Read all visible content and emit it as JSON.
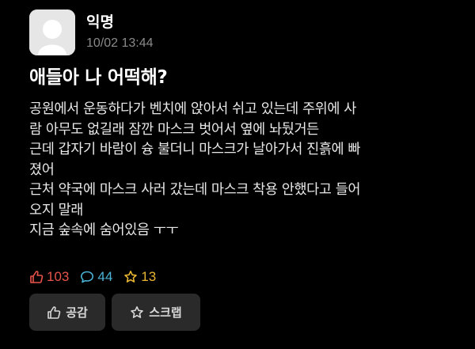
{
  "post": {
    "author": "익명",
    "date": "10/02 13:44",
    "title": "애들아 나 어떡해?",
    "content_lines": [
      "공원에서 운동하다가 벤치에 앉아서 쉬고 있는데 주위에 사",
      "람 아무도 없길래 잠깐 마스크 벗어서 옆에 놔뒀거든",
      "근데 갑자기 바람이 슝 불더니 마스크가 날아가서 진흙에 빠",
      "졌어",
      "근처 약국에 마스크 사러 갔는데 마스크 착용 안했다고 들어",
      "오지 말래",
      "지금 숲속에 숨어있음 ㅜㅜ"
    ]
  },
  "stats": {
    "likes": "103",
    "comments": "44",
    "scraps": "13"
  },
  "actions": {
    "like_label": "공감",
    "scrap_label": "스크랩"
  },
  "colors": {
    "background": "#000000",
    "like": "#e8534a",
    "comment": "#4ab3d6",
    "scrap": "#e9b631",
    "button_bg": "#2a2a2a"
  },
  "icons": {
    "like": "thumbs-up-icon",
    "comment": "speech-bubble-icon",
    "scrap": "star-icon",
    "avatar": "anonymous-avatar-icon"
  }
}
